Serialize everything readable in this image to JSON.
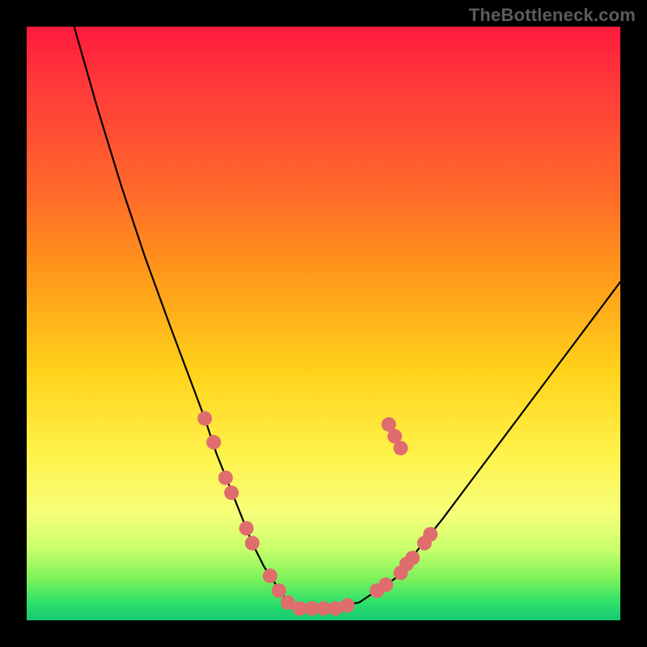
{
  "watermark": "TheBottleneck.com",
  "chart_data": {
    "type": "line",
    "title": "",
    "xlabel": "",
    "ylabel": "",
    "xlim": [
      0,
      100
    ],
    "ylim": [
      0,
      100
    ],
    "grid": false,
    "legend": false,
    "series": [
      {
        "name": "bottleneck-curve",
        "stroke": "#000000",
        "x": [
          8,
          12,
          16,
          20,
          24,
          27,
          30,
          32,
          34,
          36,
          38,
          40,
          42,
          44,
          46,
          48,
          50,
          56,
          62,
          66,
          70,
          76,
          82,
          88,
          94,
          100
        ],
        "values": [
          100,
          86,
          73,
          61,
          50,
          42,
          34,
          28,
          23,
          18,
          13,
          9,
          6,
          3,
          2,
          2,
          2,
          3,
          7,
          12,
          17,
          25,
          33,
          41,
          49,
          57
        ]
      }
    ],
    "markers": {
      "name": "highlight-points",
      "color": "#e06d6d",
      "radius_px": 9,
      "points": [
        {
          "x": 30.0,
          "y": 34.0
        },
        {
          "x": 31.5,
          "y": 30.0
        },
        {
          "x": 33.5,
          "y": 24.0
        },
        {
          "x": 34.5,
          "y": 21.5
        },
        {
          "x": 37.0,
          "y": 15.5
        },
        {
          "x": 38.0,
          "y": 13.0
        },
        {
          "x": 41.0,
          "y": 7.5
        },
        {
          "x": 42.5,
          "y": 5.0
        },
        {
          "x": 44.0,
          "y": 3.0
        },
        {
          "x": 46.0,
          "y": 2.0
        },
        {
          "x": 48.0,
          "y": 2.0
        },
        {
          "x": 50.0,
          "y": 2.0
        },
        {
          "x": 52.0,
          "y": 2.0
        },
        {
          "x": 54.0,
          "y": 2.5
        },
        {
          "x": 59.0,
          "y": 5.0
        },
        {
          "x": 60.5,
          "y": 6.0
        },
        {
          "x": 63.0,
          "y": 8.0
        },
        {
          "x": 64.0,
          "y": 9.5
        },
        {
          "x": 65.0,
          "y": 10.5
        },
        {
          "x": 67.0,
          "y": 13.0
        },
        {
          "x": 68.0,
          "y": 14.5
        },
        {
          "x": 62.0,
          "y": 31.0
        },
        {
          "x": 63.0,
          "y": 29.0
        },
        {
          "x": 61.0,
          "y": 33.0
        }
      ]
    },
    "bottom_band": {
      "name": "green-band",
      "color": "#18c870",
      "y_range": [
        0,
        3
      ]
    }
  }
}
